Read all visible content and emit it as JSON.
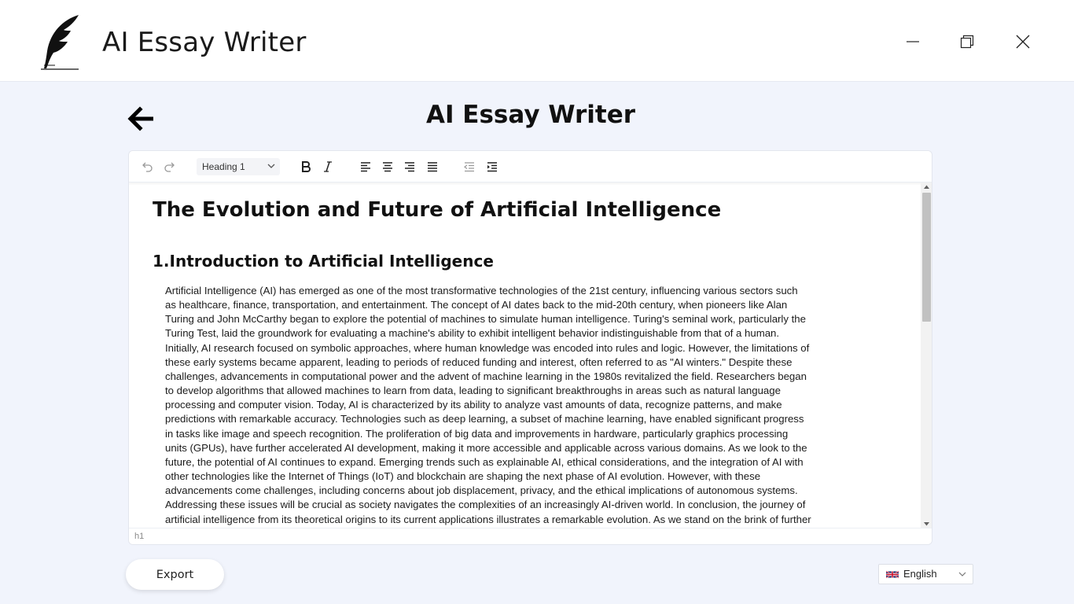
{
  "window": {
    "title": "AI Essay Writer",
    "minimize_icon": "minimize-icon",
    "maximize_icon": "restore-icon",
    "close_icon": "close-icon"
  },
  "page": {
    "heading": "AI Essay Writer",
    "back_icon": "arrow-left-icon"
  },
  "toolbar": {
    "undo_icon": "undo-icon",
    "redo_icon": "redo-icon",
    "block_format": "Heading 1",
    "bold_icon": "bold-icon",
    "italic_icon": "italic-icon",
    "align_left_icon": "align-left-icon",
    "align_center_icon": "align-center-icon",
    "align_right_icon": "align-right-icon",
    "align_justify_icon": "align-justify-icon",
    "outdent_icon": "outdent-icon",
    "indent_icon": "indent-icon"
  },
  "document": {
    "title": "The Evolution and Future of Artificial Intelligence",
    "section_heading": "1.Introduction to Artificial Intelligence",
    "paragraph": "Artificial Intelligence (AI) has emerged as one of the most transformative technologies of the 21st century, influencing various sectors such as healthcare, finance, transportation, and entertainment. The concept of AI dates back to the mid-20th century, when pioneers like Alan Turing and John McCarthy began to explore the potential of machines to simulate human intelligence. Turing's seminal work, particularly the Turing Test, laid the groundwork for evaluating a machine's ability to exhibit intelligent behavior indistinguishable from that of a human. Initially, AI research focused on symbolic approaches, where human knowledge was encoded into rules and logic. However, the limitations of these early systems became apparent, leading to periods of reduced funding and interest, often referred to as \"AI winters.\" Despite these challenges, advancements in computational power and the advent of machine learning in the 1980s revitalized the field. Researchers began to develop algorithms that allowed machines to learn from data, leading to significant breakthroughs in areas such as natural language processing and computer vision. Today, AI is characterized by its ability to analyze vast amounts of data, recognize patterns, and make predictions with remarkable accuracy. Technologies such as deep learning, a subset of machine learning, have enabled significant progress in tasks like image and speech recognition. The proliferation of big data and improvements in hardware, particularly graphics processing units (GPUs), have further accelerated AI development, making it more accessible and applicable across various domains. As we look to the future, the potential of AI continues to expand. Emerging trends such as explainable AI, ethical considerations, and the integration of AI with other technologies like the Internet of Things (IoT) and blockchain are shaping the next phase of AI evolution. However, with these advancements come challenges, including concerns about job displacement, privacy, and the ethical implications of autonomous systems. Addressing these issues will be crucial as society navigates the complexities of an increasingly AI-driven world. In conclusion, the journey of artificial intelligence from its theoretical origins to its current applications illustrates a remarkable evolution. As we stand on the brink of further innovations, understanding the"
  },
  "status": {
    "path": "h1"
  },
  "footer": {
    "export_label": "Export",
    "language": "English",
    "language_flag": "uk-flag-icon"
  },
  "colors": {
    "background": "#f1f4fc",
    "surface": "#ffffff",
    "text": "#111111"
  }
}
